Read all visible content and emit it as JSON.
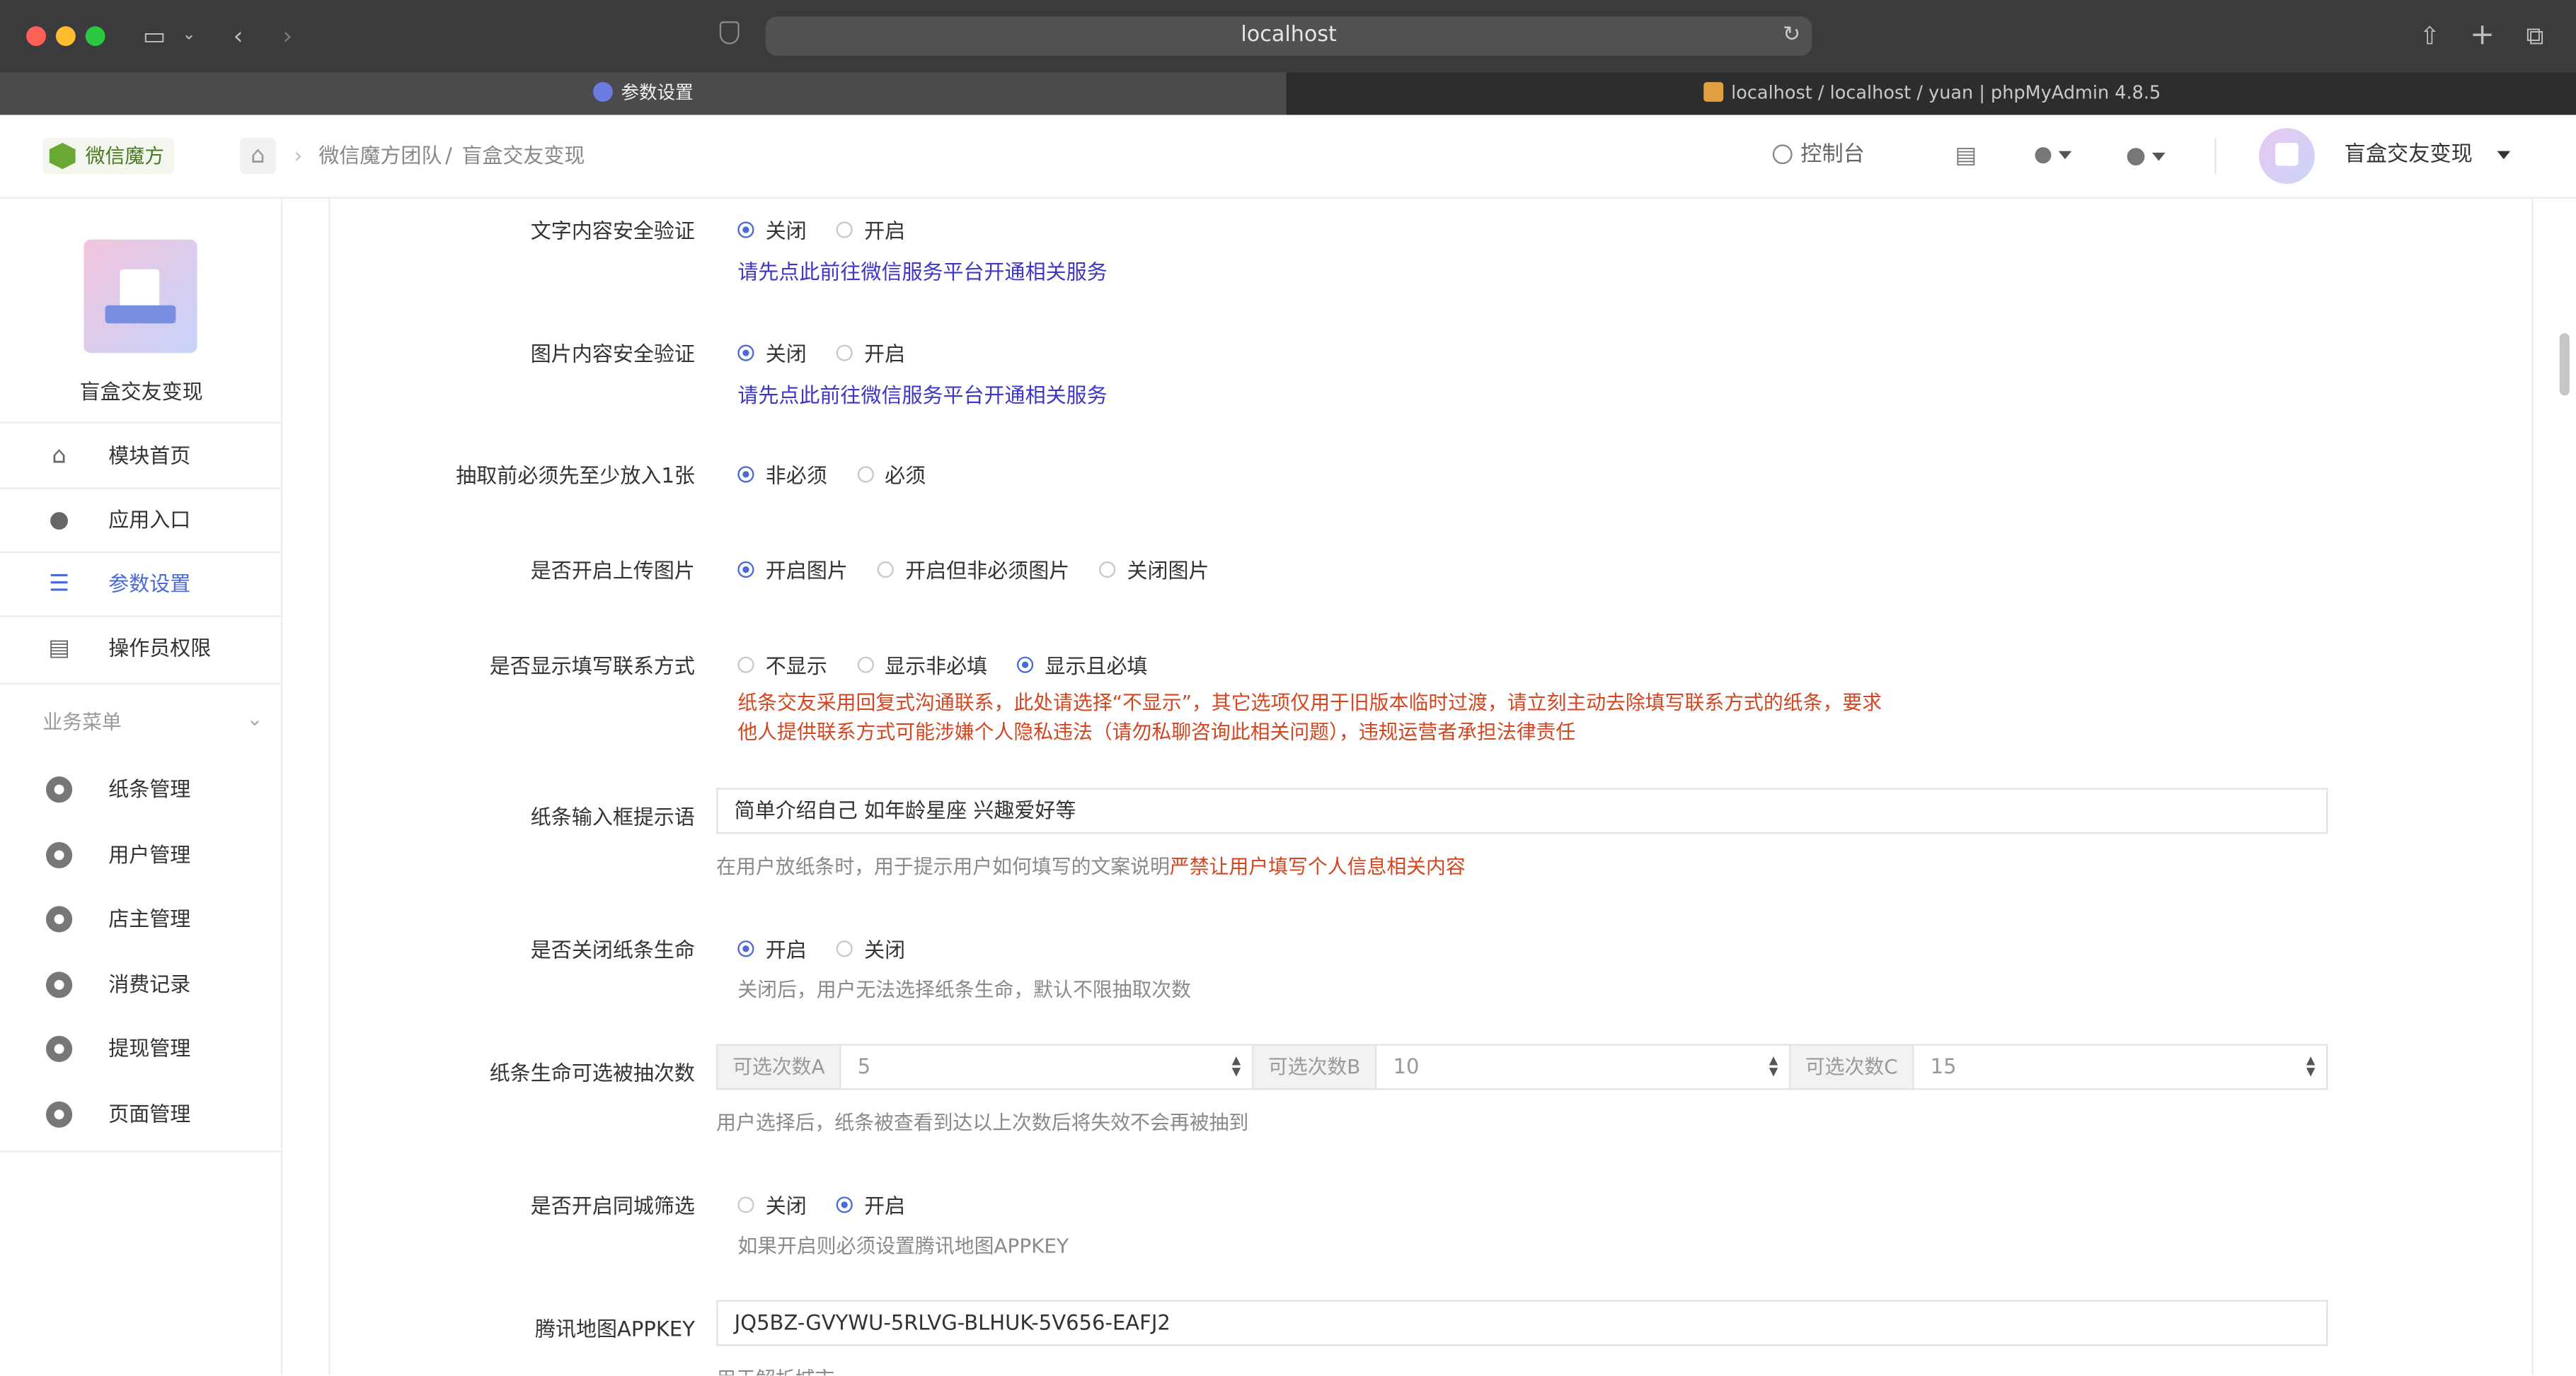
{
  "browser": {
    "url": "localhost",
    "tabs": [
      {
        "title": "参数设置",
        "active": true
      },
      {
        "title": "localhost / localhost / yuan | phpMyAdmin 4.8.5",
        "active": false
      }
    ]
  },
  "header": {
    "logo_text": "微信魔方",
    "breadcrumb": [
      "微信魔方团队",
      "盲盒交友变现"
    ],
    "breadcrumb_sep": "/",
    "console": "控制台",
    "account_name": "盲盒交友变现"
  },
  "sidebar": {
    "app_name": "盲盒交友变现",
    "top_items": [
      {
        "label": "模块首页",
        "icon": "home-icon"
      },
      {
        "label": "应用入口",
        "icon": "chat-icon"
      },
      {
        "label": "参数设置",
        "icon": "list-icon",
        "active": true
      },
      {
        "label": "操作员权限",
        "icon": "document-icon"
      }
    ],
    "section_title": "业务菜单",
    "biz_items": [
      {
        "label": "纸条管理",
        "icon": "gear-icon"
      },
      {
        "label": "用户管理",
        "icon": "gear-icon"
      },
      {
        "label": "店主管理",
        "icon": "gear-icon"
      },
      {
        "label": "消费记录",
        "icon": "gear-icon"
      },
      {
        "label": "提现管理",
        "icon": "gear-icon"
      },
      {
        "label": "页面管理",
        "icon": "gear-icon"
      }
    ]
  },
  "form": {
    "text_check": {
      "label": "文字内容安全验证",
      "options": [
        "关闭",
        "开启"
      ],
      "selected": 0,
      "link": "请先点此前往微信服务平台开通相关服务"
    },
    "image_check": {
      "label": "图片内容安全验证",
      "options": [
        "关闭",
        "开启"
      ],
      "selected": 0,
      "link": "请先点此前往微信服务平台开通相关服务"
    },
    "draw_require": {
      "label": "抽取前必须先至少放入1张",
      "options": [
        "非必须",
        "必须"
      ],
      "selected": 0
    },
    "upload_image": {
      "label": "是否开启上传图片",
      "options": [
        "开启图片",
        "开启但非必须图片",
        "关闭图片"
      ],
      "selected": 0
    },
    "contact": {
      "label": "是否显示填写联系方式",
      "options": [
        "不显示",
        "显示非必填",
        "显示且必填"
      ],
      "selected": 2,
      "warn_line1": "纸条交友采用回复式沟通联系，此处请选择“不显示”，其它选项仅用于旧版本临时过渡，请立刻主动去除填写联系方式的纸条，要求",
      "warn_line2": "他人提供联系方式可能涉嫌个人隐私违法（请勿私聊咨询此相关问题），违规运营者承担法律责任"
    },
    "placeholder_tip": {
      "label": "纸条输入框提示语",
      "value": "简单介绍自己 如年龄星座 兴趣爱好等",
      "help": "在用户放纸条时，用于提示用户如何填写的文案说明",
      "help_red": "严禁让用户填写个人信息相关内容"
    },
    "life_toggle": {
      "label": "是否关闭纸条生命",
      "options": [
        "开启",
        "关闭"
      ],
      "selected": 0,
      "help": "关闭后，用户无法选择纸条生命，默认不限抽取次数"
    },
    "life_counts": {
      "label": "纸条生命可选被抽次数",
      "fields": [
        {
          "addon": "可选次数A",
          "value": "5"
        },
        {
          "addon": "可选次数B",
          "value": "10"
        },
        {
          "addon": "可选次数C",
          "value": "15"
        }
      ],
      "help": "用户选择后，纸条被查看到达以上次数后将失效不会再被抽到"
    },
    "city_filter": {
      "label": "是否开启同城筛选",
      "options": [
        "关闭",
        "开启"
      ],
      "selected": 1,
      "help": "如果开启则必须设置腾讯地图APPKEY"
    },
    "map_key": {
      "label": "腾讯地图APPKEY",
      "value": "JQ5BZ-GVYWU-5RLVG-BLHUK-5V656-EAFJ2",
      "help": "用于解析城市"
    }
  },
  "colors": {
    "accent": "#4a6ad8",
    "link": "#3c37c7",
    "warn": "#d3461f"
  }
}
